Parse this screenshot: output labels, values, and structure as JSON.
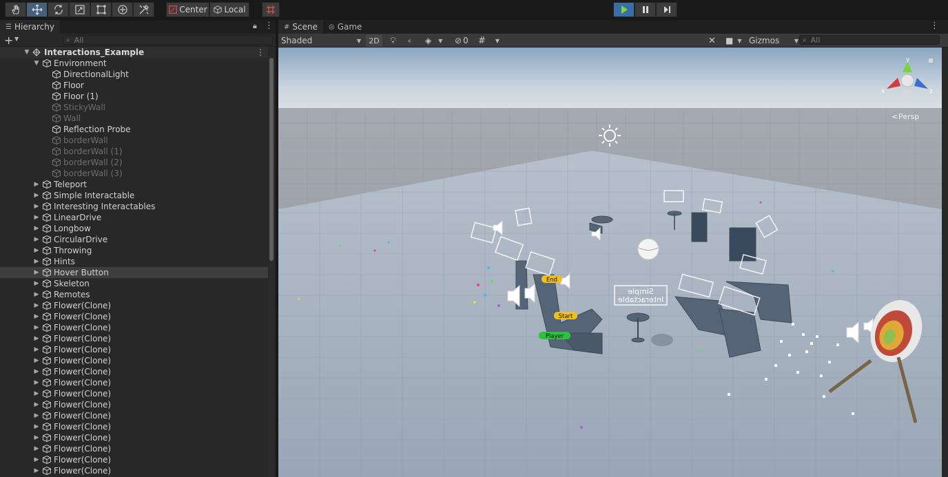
{
  "toolbar": {
    "tools": [
      {
        "icon": "hand-icon"
      },
      {
        "icon": "move-icon",
        "active": true
      },
      {
        "icon": "rotate-icon"
      },
      {
        "icon": "scale-icon"
      },
      {
        "icon": "rect-tool-icon"
      },
      {
        "icon": "transform-tool-icon"
      },
      {
        "icon": "custom-tools-icon"
      }
    ],
    "pivot_label": "Center",
    "space_label": "Local",
    "play_active": true,
    "colors": {
      "active": "#46607c",
      "play": "#3a6ea5",
      "play_icon": "#7cd63f"
    }
  },
  "hierarchy": {
    "tab_label": "Hierarchy",
    "search_placeholder": "All",
    "scene_name": "Interactions_Example",
    "items": [
      {
        "name": "Environment",
        "indent": 1,
        "expanded": true,
        "has_children": true
      },
      {
        "name": "DirectionalLight",
        "indent": 2
      },
      {
        "name": "Floor",
        "indent": 2
      },
      {
        "name": "Floor (1)",
        "indent": 2
      },
      {
        "name": "StickyWall",
        "indent": 2,
        "disabled": true
      },
      {
        "name": "Wall",
        "indent": 2,
        "disabled": true
      },
      {
        "name": "Reflection Probe",
        "indent": 2
      },
      {
        "name": "borderWall",
        "indent": 2,
        "disabled": true
      },
      {
        "name": "borderWall (1)",
        "indent": 2,
        "disabled": true
      },
      {
        "name": "borderWall (2)",
        "indent": 2,
        "disabled": true
      },
      {
        "name": "borderWall (3)",
        "indent": 2,
        "disabled": true
      },
      {
        "name": "Teleport",
        "indent": 1,
        "has_children": true
      },
      {
        "name": "Simple Interactable",
        "indent": 1,
        "has_children": true
      },
      {
        "name": "Interesting Interactables",
        "indent": 1,
        "has_children": true
      },
      {
        "name": "LinearDrive",
        "indent": 1,
        "has_children": true
      },
      {
        "name": "Longbow",
        "indent": 1,
        "has_children": true
      },
      {
        "name": "CircularDrive",
        "indent": 1,
        "has_children": true
      },
      {
        "name": "Throwing",
        "indent": 1,
        "has_children": true
      },
      {
        "name": "Hints",
        "indent": 1,
        "has_children": true
      },
      {
        "name": "Hover Button",
        "indent": 1,
        "has_children": true,
        "selected": true
      },
      {
        "name": "Skeleton",
        "indent": 1,
        "has_children": true
      },
      {
        "name": "Remotes",
        "indent": 1,
        "has_children": true
      },
      {
        "name": "Flower(Clone)",
        "indent": 1,
        "has_children": true
      },
      {
        "name": "Flower(Clone)",
        "indent": 1,
        "has_children": true
      },
      {
        "name": "Flower(Clone)",
        "indent": 1,
        "has_children": true
      },
      {
        "name": "Flower(Clone)",
        "indent": 1,
        "has_children": true
      },
      {
        "name": "Flower(Clone)",
        "indent": 1,
        "has_children": true
      },
      {
        "name": "Flower(Clone)",
        "indent": 1,
        "has_children": true
      },
      {
        "name": "Flower(Clone)",
        "indent": 1,
        "has_children": true
      },
      {
        "name": "Flower(Clone)",
        "indent": 1,
        "has_children": true
      },
      {
        "name": "Flower(Clone)",
        "indent": 1,
        "has_children": true
      },
      {
        "name": "Flower(Clone)",
        "indent": 1,
        "has_children": true
      },
      {
        "name": "Flower(Clone)",
        "indent": 1,
        "has_children": true
      },
      {
        "name": "Flower(Clone)",
        "indent": 1,
        "has_children": true
      },
      {
        "name": "Flower(Clone)",
        "indent": 1,
        "has_children": true
      },
      {
        "name": "Flower(Clone)",
        "indent": 1,
        "has_children": true
      },
      {
        "name": "Flower(Clone)",
        "indent": 1,
        "has_children": true
      },
      {
        "name": "Flower(Clone)",
        "indent": 1,
        "has_children": true
      }
    ]
  },
  "scene_panel": {
    "tabs": [
      {
        "label": "Scene",
        "icon": "grid-icon",
        "active": true
      },
      {
        "label": "Game",
        "icon": "gamepad-icon",
        "active": false
      }
    ],
    "draw_mode": "Shaded",
    "mode_2d_label": "2D",
    "hidden_count": "0",
    "gizmos_label": "Gizmos",
    "search_placeholder": "All",
    "projection_label": "Persp",
    "gizmo_axes": {
      "x": "x",
      "y": "y",
      "z": "z"
    },
    "axis_colors": {
      "x": "#d23c3c",
      "y": "#7bd23c",
      "z": "#3c6ed2"
    }
  },
  "viewport_labels": {
    "end": "End",
    "start": "Start",
    "player": "Player",
    "simple_interactable": "Simple\nInteractable"
  }
}
